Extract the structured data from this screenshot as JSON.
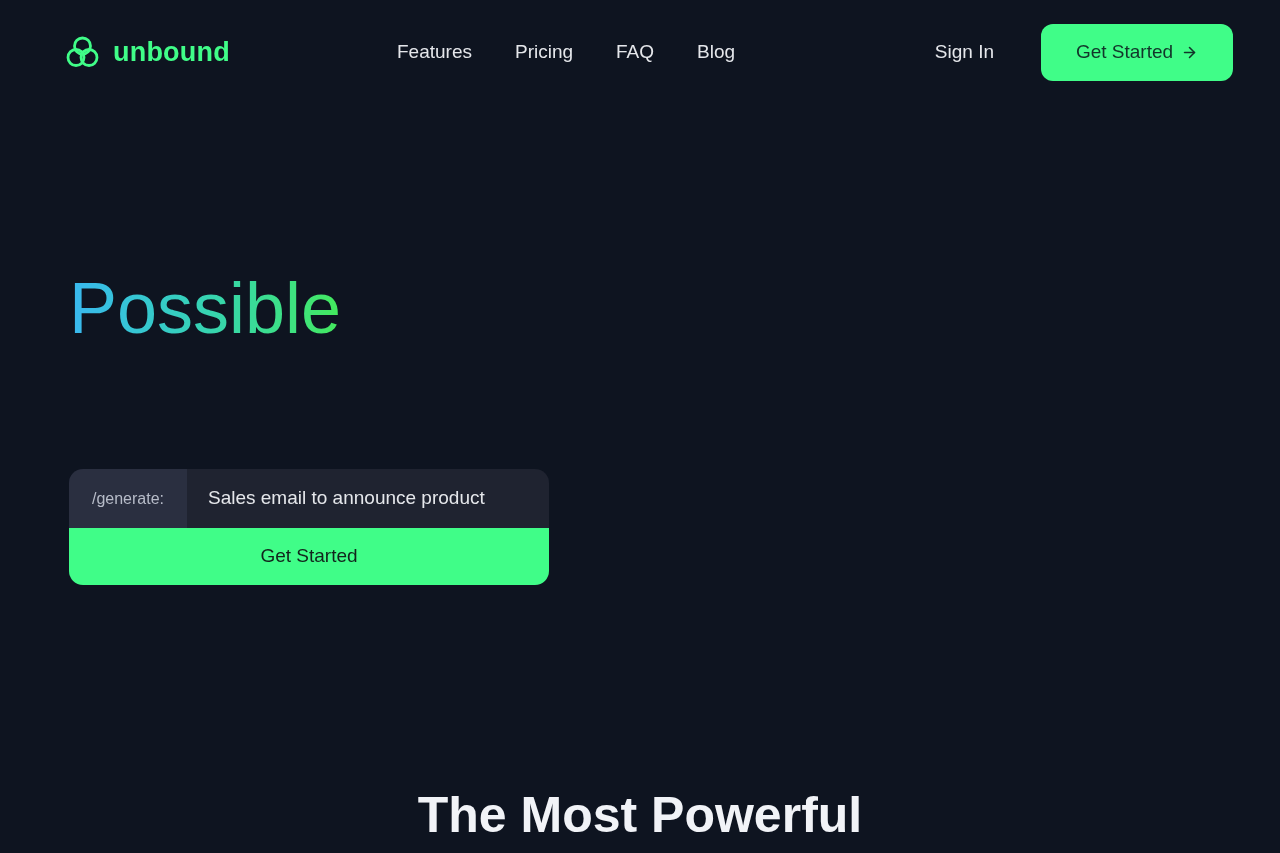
{
  "logo": {
    "text": "unbound"
  },
  "nav": {
    "links": [
      {
        "label": "Features"
      },
      {
        "label": "Pricing"
      },
      {
        "label": "FAQ"
      },
      {
        "label": "Blog"
      }
    ],
    "sign_in": "Sign In",
    "cta": "Get Started"
  },
  "hero": {
    "headline": "Possible",
    "prompt": {
      "prefix": "/generate:",
      "value": "Sales email to announce product"
    },
    "button": "Get Started"
  },
  "section": {
    "heading": "The Most Powerful"
  }
}
